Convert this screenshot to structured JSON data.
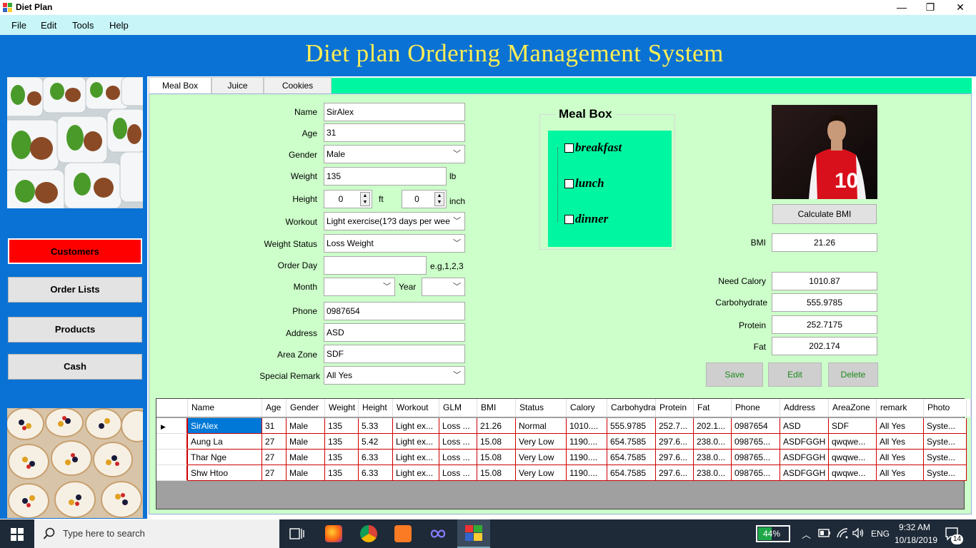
{
  "window": {
    "title": "Diet Plan",
    "minimize": "—",
    "maximize": "❐",
    "close": "✕"
  },
  "menu": [
    "File",
    "Edit",
    "Tools",
    "Help"
  ],
  "banner_title": "Diet plan Ordering Management System",
  "sidebar": {
    "buttons": [
      "Customers",
      "Order Lists",
      "Products",
      "Cash"
    ],
    "active_color": "#ff0000"
  },
  "tabs": [
    "Meal Box",
    "Juice",
    "Cookies"
  ],
  "form": {
    "name_label": "Name",
    "name": "SirAlex",
    "age_label": "Age",
    "age": "31",
    "gender_label": "Gender",
    "gender": "Male",
    "weight_label": "Weight",
    "weight": "135",
    "weight_unit": "lb",
    "height_label": "Height",
    "height_ft": "0",
    "ft_unit": "ft",
    "height_inch": "0",
    "inch_unit": "inch",
    "workout_label": "Workout",
    "workout": "Light exercise(1?3 days per wee",
    "weight_status_label": "Weight Status",
    "weight_status": "Loss Weight",
    "order_day_label": "Order Day",
    "order_day": "",
    "order_day_hint": "e.g,1,2,3",
    "month_label": "Month",
    "month": "",
    "year_label": "Year",
    "year": "",
    "phone_label": "Phone",
    "phone": "0987654",
    "address_label": "Address",
    "address": "ASD",
    "area_zone_label": "Area Zone",
    "area_zone": "SDF",
    "special_remark_label": "Special Remark",
    "special_remark": "All Yes"
  },
  "meal_box": {
    "title": "Meal Box",
    "items": [
      "breakfast",
      "lunch",
      "dinner"
    ]
  },
  "bmi": {
    "calc_button": "Calculate BMI",
    "bmi_label": "BMI",
    "bmi": "21.26",
    "need_calory_label": "Need Calory",
    "need_calory": "1010.87",
    "carbohydrate_label": "Carbohydrate",
    "carbohydrate": "555.9785",
    "protein_label": "Protein",
    "protein": "252.7175",
    "fat_label": "Fat",
    "fat": "202.174"
  },
  "actions": [
    "Save",
    "Edit",
    "Delete"
  ],
  "grid": {
    "columns": [
      "Name",
      "Age",
      "Gender",
      "Weight",
      "Height",
      "Workout",
      "GLM",
      "BMI",
      "Status",
      "Calory",
      "Carbohydra",
      "Protein",
      "Fat",
      "Phone",
      "Address",
      "AreaZone",
      "remark",
      "Photo"
    ],
    "rows": [
      [
        "SirAlex",
        "31",
        "Male",
        "135",
        "5.33",
        "Light ex...",
        "Loss ...",
        "21.26",
        "Normal",
        "1010....",
        "555.9785",
        "252.7...",
        "202.1...",
        "0987654",
        "ASD",
        "SDF",
        "All Yes",
        "Syste..."
      ],
      [
        "Aung La",
        "27",
        "Male",
        "135",
        "5.42",
        "Light ex...",
        "Loss ...",
        "15.08",
        "Very Low",
        "1190....",
        "654.7585",
        "297.6...",
        "238.0...",
        "098765...",
        "ASDFGGH",
        "qwqwe...",
        "All Yes",
        "Syste..."
      ],
      [
        "Thar Nge",
        "27",
        "Male",
        "135",
        "6.33",
        "Light ex...",
        "Loss ...",
        "15.08",
        "Very Low",
        "1190....",
        "654.7585",
        "297.6...",
        "238.0...",
        "098765...",
        "ASDFGGH",
        "qwqwe...",
        "All Yes",
        "Syste..."
      ],
      [
        "Shw Htoo",
        "27",
        "Male",
        "135",
        "6.33",
        "Light ex...",
        "Loss ...",
        "15.08",
        "Very Low",
        "1190....",
        "654.7585",
        "297.6...",
        "238.0...",
        "098765...",
        "ASDFGGH",
        "qwqwe...",
        "All Yes",
        "Syste..."
      ]
    ]
  },
  "taskbar": {
    "search_placeholder": "Type here to search",
    "battery": "44%",
    "language": "ENG",
    "time": "9:32 AM",
    "date": "10/18/2019",
    "notifications": "14"
  }
}
